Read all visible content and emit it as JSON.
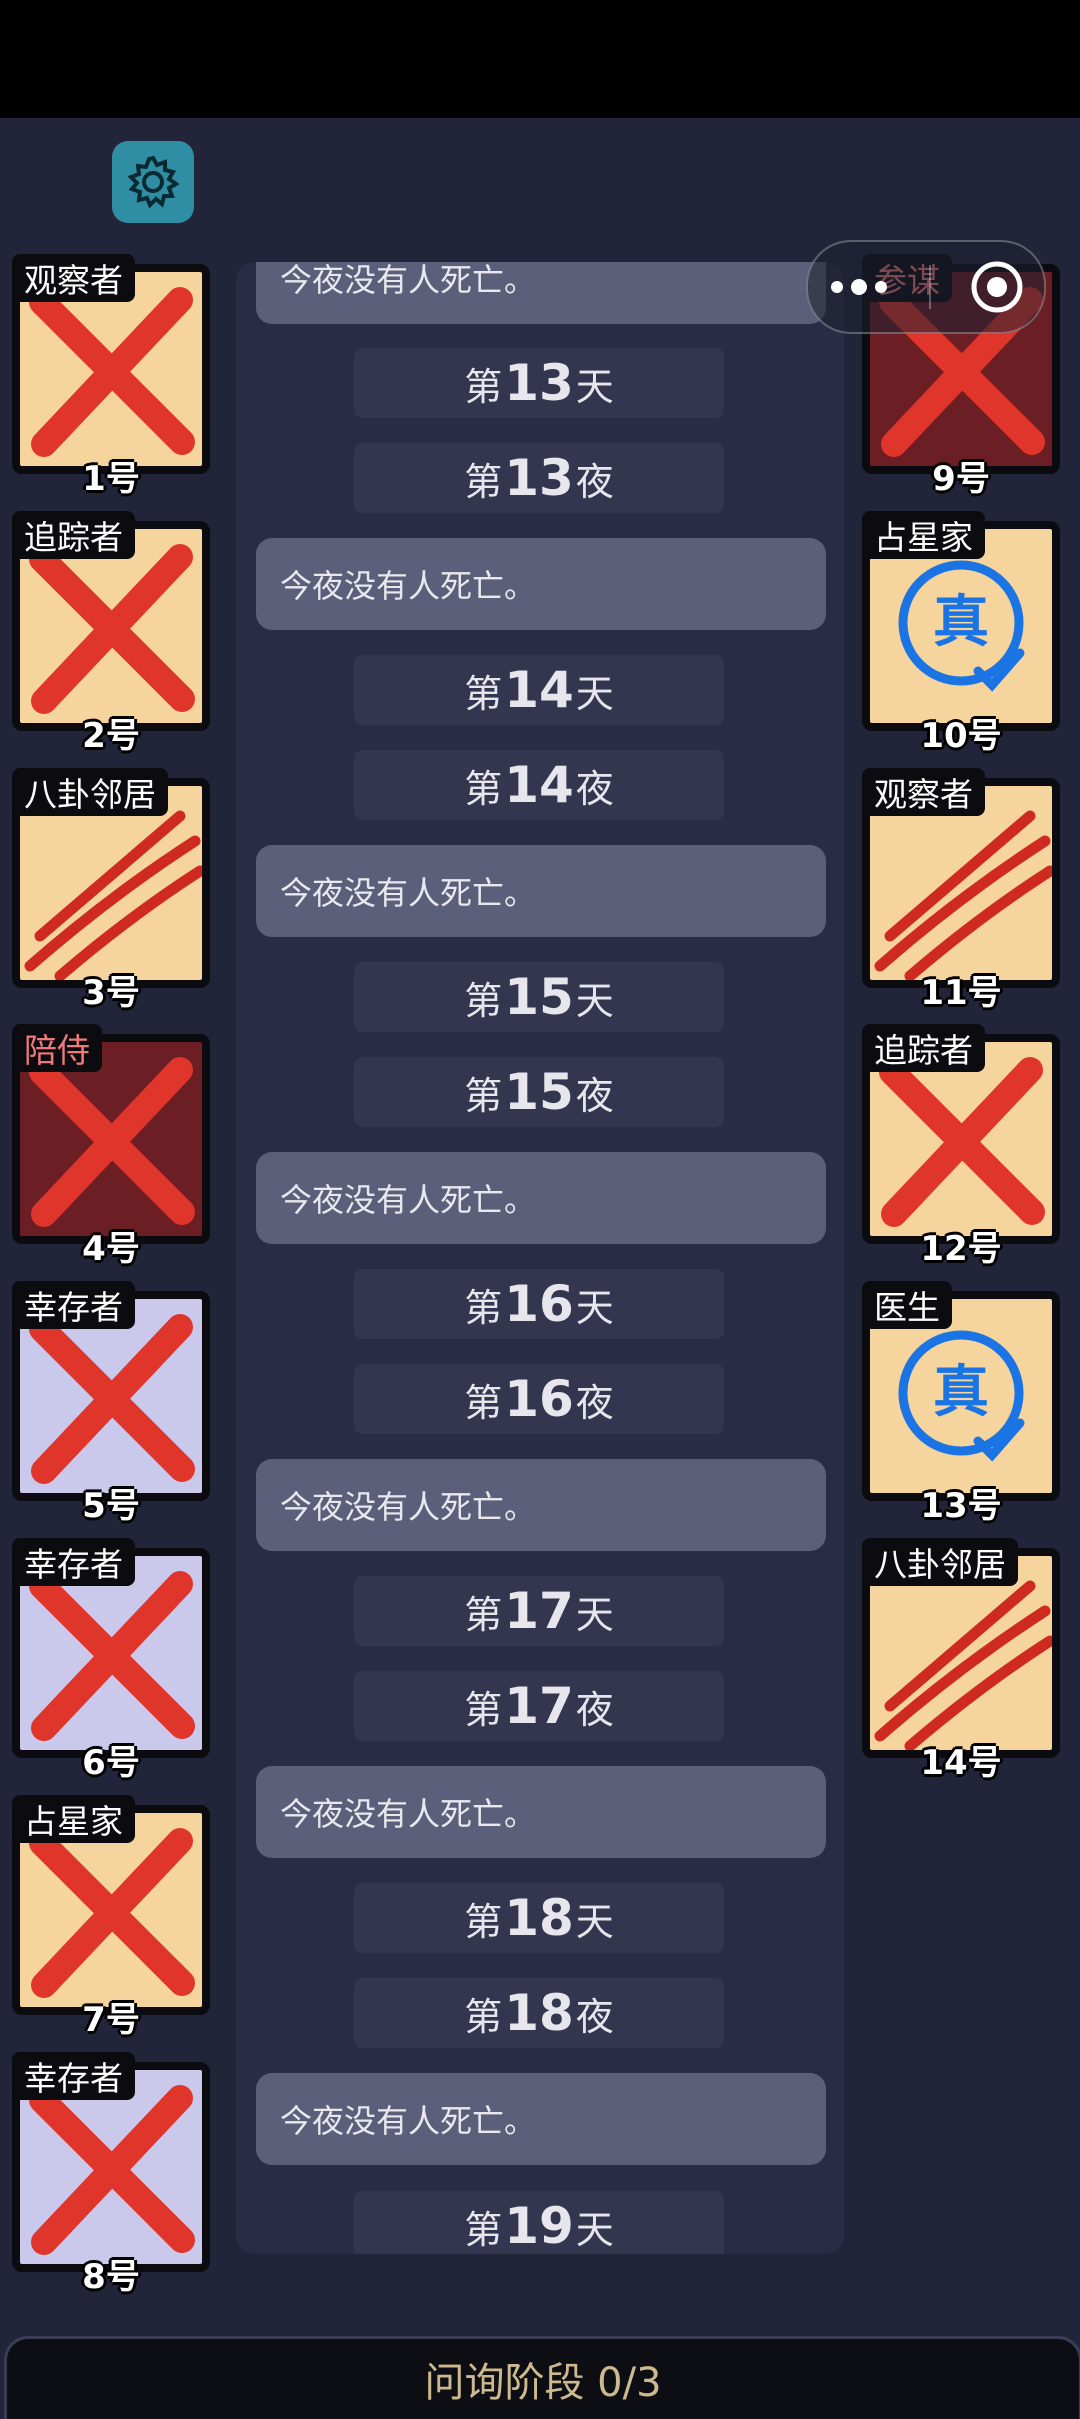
{
  "log": {
    "top_message": "今夜没有人死亡。",
    "entries": [
      {
        "type": "day",
        "prefix": "第",
        "num": "13",
        "suffix": "天"
      },
      {
        "type": "day",
        "prefix": "第",
        "num": "13",
        "suffix": "夜"
      },
      {
        "type": "msg",
        "text": "今夜没有人死亡。"
      },
      {
        "type": "day",
        "prefix": "第",
        "num": "14",
        "suffix": "天"
      },
      {
        "type": "day",
        "prefix": "第",
        "num": "14",
        "suffix": "夜"
      },
      {
        "type": "msg",
        "text": "今夜没有人死亡。"
      },
      {
        "type": "day",
        "prefix": "第",
        "num": "15",
        "suffix": "天"
      },
      {
        "type": "day",
        "prefix": "第",
        "num": "15",
        "suffix": "夜"
      },
      {
        "type": "msg",
        "text": "今夜没有人死亡。"
      },
      {
        "type": "day",
        "prefix": "第",
        "num": "16",
        "suffix": "天"
      },
      {
        "type": "day",
        "prefix": "第",
        "num": "16",
        "suffix": "夜"
      },
      {
        "type": "msg",
        "text": "今夜没有人死亡。"
      },
      {
        "type": "day",
        "prefix": "第",
        "num": "17",
        "suffix": "天"
      },
      {
        "type": "day",
        "prefix": "第",
        "num": "17",
        "suffix": "夜"
      },
      {
        "type": "msg",
        "text": "今夜没有人死亡。"
      },
      {
        "type": "day",
        "prefix": "第",
        "num": "18",
        "suffix": "天"
      },
      {
        "type": "day",
        "prefix": "第",
        "num": "18",
        "suffix": "夜"
      },
      {
        "type": "msg",
        "text": "今夜没有人死亡。"
      },
      {
        "type": "day",
        "prefix": "第",
        "num": "19",
        "suffix": "天"
      }
    ]
  },
  "players_left": [
    {
      "role": "观察者",
      "number": "1号",
      "bg": "tan",
      "mark": "x"
    },
    {
      "role": "追踪者",
      "number": "2号",
      "bg": "tan",
      "mark": "x"
    },
    {
      "role": "八卦邻居",
      "number": "3号",
      "bg": "tan",
      "mark": "claw"
    },
    {
      "role": "陪侍",
      "number": "4号",
      "bg": "red",
      "mark": "x"
    },
    {
      "role": "幸存者",
      "number": "5号",
      "bg": "lav",
      "mark": "x"
    },
    {
      "role": "幸存者",
      "number": "6号",
      "bg": "lav",
      "mark": "x"
    },
    {
      "role": "占星家",
      "number": "7号",
      "bg": "tan",
      "mark": "x"
    },
    {
      "role": "幸存者",
      "number": "8号",
      "bg": "lav",
      "mark": "x"
    }
  ],
  "players_right": [
    {
      "role": "参谋",
      "number": "9号",
      "bg": "red",
      "mark": "x"
    },
    {
      "role": "占星家",
      "number": "10号",
      "bg": "tan",
      "mark": "true",
      "stamp": "真"
    },
    {
      "role": "观察者",
      "number": "11号",
      "bg": "tan",
      "mark": "claw"
    },
    {
      "role": "追踪者",
      "number": "12号",
      "bg": "tan",
      "mark": "x"
    },
    {
      "role": "医生",
      "number": "13号",
      "bg": "tan",
      "mark": "true",
      "stamp": "真"
    },
    {
      "role": "八卦邻居",
      "number": "14号",
      "bg": "tan",
      "mark": "claw"
    }
  ],
  "bottom_bar": {
    "label": "问询阶段 0/3"
  },
  "colors": {
    "x_mark": "#e0352b",
    "stamp": "#1b74e4",
    "claw": "#cf2a22"
  },
  "icons": {
    "settings": "gear-icon",
    "menu": "more-dots-icon",
    "close": "target-circle-icon"
  }
}
